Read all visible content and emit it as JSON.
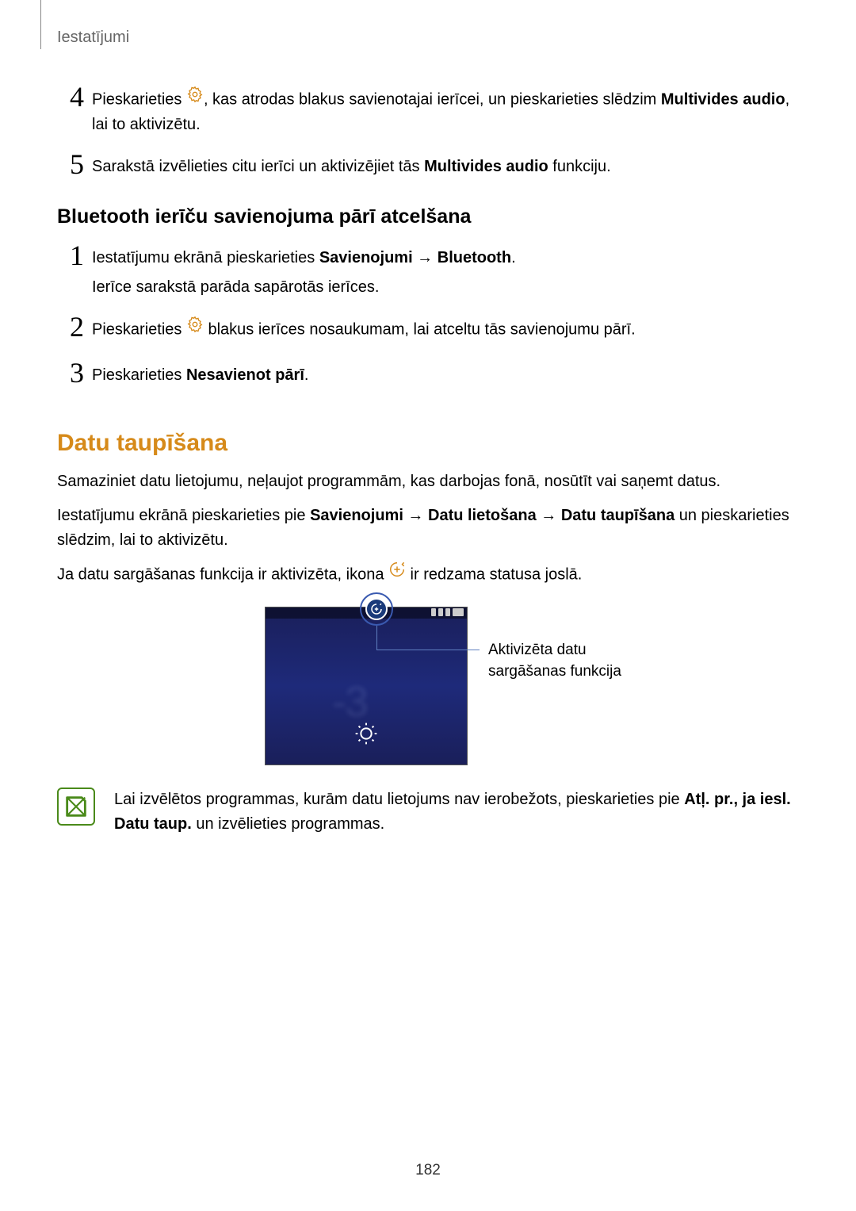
{
  "header": {
    "title": "Iestatījumi"
  },
  "stepsA": {
    "s4": {
      "num": "4",
      "t1": "Pieskarieties ",
      "t2": ", kas atrodas blakus savienotajai ierīcei, un pieskarieties slēdzim ",
      "b1": "Multivides audio",
      "t3": ", lai to aktivizētu."
    },
    "s5": {
      "num": "5",
      "t1": "Sarakstā izvēlieties citu ierīci un aktivizējiet tās ",
      "b1": "Multivides audio",
      "t2": " funkciju."
    }
  },
  "subHeading": "Bluetooth ierīču savienojuma pārī atcelšana",
  "stepsB": {
    "s1": {
      "num": "1",
      "t1": "Iestatījumu ekrānā pieskarieties ",
      "b1": "Savienojumi",
      "arrow": " → ",
      "b2": "Bluetooth",
      "dot": ".",
      "sub": "Ierīce sarakstā parāda sapārotās ierīces."
    },
    "s2": {
      "num": "2",
      "t1": "Pieskarieties ",
      "t2": " blakus ierīces nosaukumam, lai atceltu tās savienojumu pārī."
    },
    "s3": {
      "num": "3",
      "t1": "Pieskarieties ",
      "b1": "Nesavienot pārī",
      "dot": "."
    }
  },
  "sectionTitle": "Datu taupīšana",
  "para1": "Samaziniet datu lietojumu, neļaujot programmām, kas darbojas fonā, nosūtīt vai saņemt datus.",
  "para2": {
    "t1": "Iestatījumu ekrānā pieskarieties pie ",
    "b1": "Savienojumi",
    "arrow1": " → ",
    "b2": "Datu lietošana",
    "arrow2": " → ",
    "b3": "Datu taupīšana",
    "t2": " un pieskarieties slēdzim, lai to aktivizētu."
  },
  "para3": {
    "t1": "Ja datu sargāšanas funkcija ir aktivizēta, ikona ",
    "t2": " ir redzama statusa joslā."
  },
  "callout": "Aktivizēta datu sargāšanas funkcija",
  "brightnessNum": "-3",
  "note": {
    "t1": "Lai izvēlētos programmas, kurām datu lietojums nav ierobežots, pieskarieties pie ",
    "b1": "Atļ. pr., ja iesl. Datu taup.",
    "t2": " un izvēlieties programmas."
  },
  "pageNum": "182"
}
